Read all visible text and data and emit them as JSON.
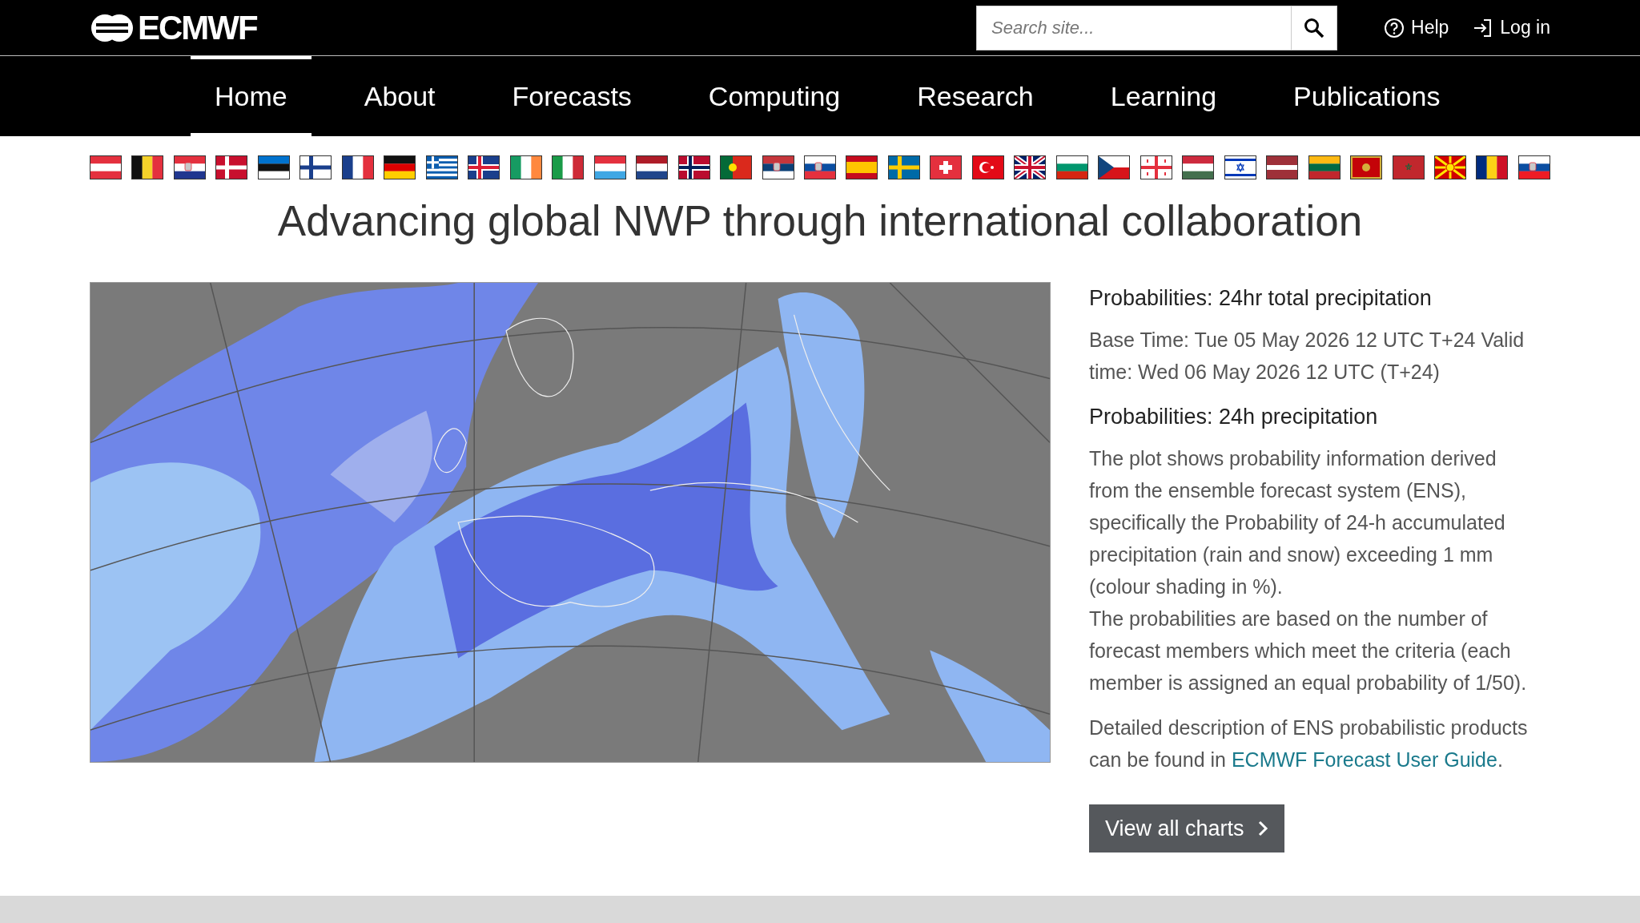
{
  "header": {
    "logo_text": "ECMWF",
    "search": {
      "placeholder": "Search site..."
    },
    "links": [
      {
        "kind": "help",
        "label": "Help"
      },
      {
        "kind": "login",
        "label": "Log in"
      }
    ]
  },
  "nav": [
    {
      "label": "Home",
      "selected": true
    },
    {
      "label": "About",
      "selected": false
    },
    {
      "label": "Forecasts",
      "selected": false
    },
    {
      "label": "Computing",
      "selected": false
    },
    {
      "label": "Research",
      "selected": false
    },
    {
      "label": "Learning",
      "selected": false
    },
    {
      "label": "Publications",
      "selected": false
    }
  ],
  "title": "Advancing global NWP through international collaboration",
  "info": {
    "heading": "Probabilities: 24hr total precipitation",
    "base_time": "Base Time: Tue 05 May 2026 12 UTC T+24 Valid time: Wed 06 May 2026 12 UTC (T+24)",
    "subheading": "Probabilities: 24h precipitation",
    "paragraphs": [
      "The plot shows probability information derived from the ensemble forecast system (ENS), specifically the Probability of 24-h accumulated precipitation (rain and snow) exceeding 1 mm (colour shading in %).",
      "The probabilities are based on the number of forecast members which meet the criteria (each member is assigned an equal probability of 1/50)."
    ],
    "detail": {
      "text": "Detailed description of ENS probabilistic products can be found in ",
      "link": "ECMWF Forecast User Guide",
      "after": "."
    },
    "button": "View all charts"
  }
}
